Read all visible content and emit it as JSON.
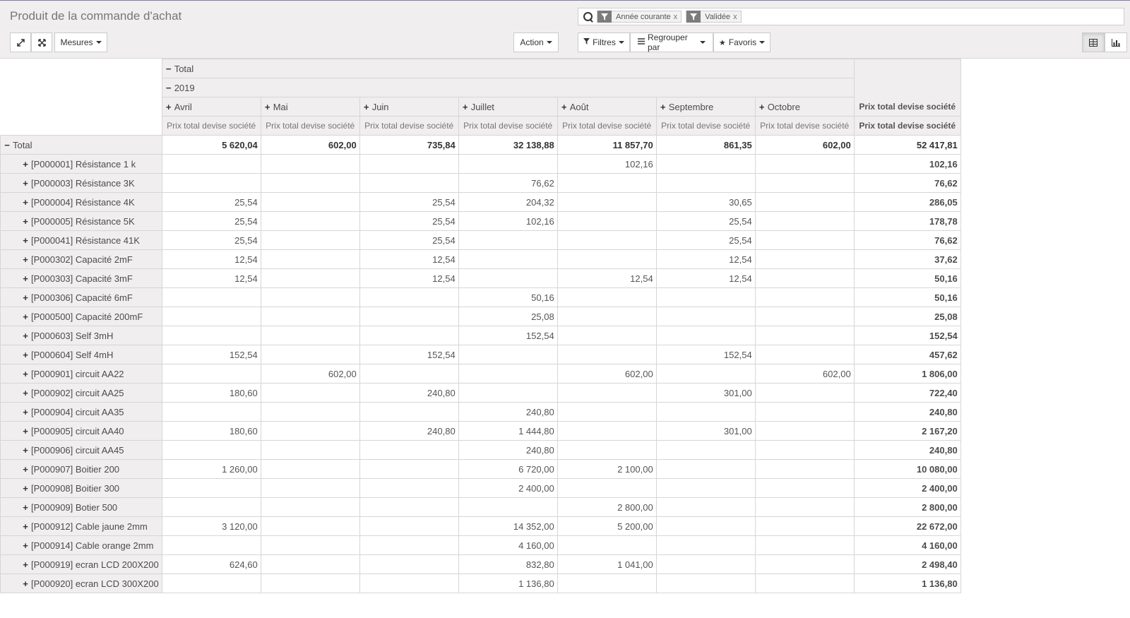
{
  "header": {
    "title": "Produit de la commande d'achat",
    "facets": [
      {
        "label": "Année courante",
        "remove": "x"
      },
      {
        "label": "Validée",
        "remove": "x"
      }
    ]
  },
  "toolbar": {
    "measures": "Mesures",
    "action": "Action",
    "filters": "Filtres",
    "group_by": "Regrouper par",
    "favorites": "Favoris"
  },
  "pivot": {
    "col_total": "Total",
    "year": "2019",
    "months": [
      "Avril",
      "Mai",
      "Juin",
      "Juillet",
      "Août",
      "Septembre",
      "Octobre"
    ],
    "measure": "Prix total devise société",
    "total_measure": "Prix total devise société",
    "row_total_label": "Total",
    "total_row": [
      "5 620,04",
      "602,00",
      "735,84",
      "32 138,88",
      "11 857,70",
      "861,35",
      "602,00",
      "52 417,81"
    ],
    "rows": [
      {
        "label": "[P000001] Résistance 1 k",
        "values": [
          "",
          "",
          "",
          "",
          "102,16",
          "",
          "",
          "102,16"
        ]
      },
      {
        "label": "[P000003] Résistance 3K",
        "values": [
          "",
          "",
          "",
          "76,62",
          "",
          "",
          "",
          "76,62"
        ]
      },
      {
        "label": "[P000004] Résistance 4K",
        "values": [
          "25,54",
          "",
          "25,54",
          "204,32",
          "",
          "30,65",
          "",
          "286,05"
        ]
      },
      {
        "label": "[P000005] Résistance 5K",
        "values": [
          "25,54",
          "",
          "25,54",
          "102,16",
          "",
          "25,54",
          "",
          "178,78"
        ]
      },
      {
        "label": "[P000041] Résistance 41K",
        "values": [
          "25,54",
          "",
          "25,54",
          "",
          "",
          "25,54",
          "",
          "76,62"
        ]
      },
      {
        "label": "[P000302] Capacité 2mF",
        "values": [
          "12,54",
          "",
          "12,54",
          "",
          "",
          "12,54",
          "",
          "37,62"
        ]
      },
      {
        "label": "[P000303] Capacité 3mF",
        "values": [
          "12,54",
          "",
          "12,54",
          "",
          "12,54",
          "12,54",
          "",
          "50,16"
        ]
      },
      {
        "label": "[P000306] Capacité 6mF",
        "values": [
          "",
          "",
          "",
          "50,16",
          "",
          "",
          "",
          "50,16"
        ]
      },
      {
        "label": "[P000500] Capacité 200mF",
        "values": [
          "",
          "",
          "",
          "25,08",
          "",
          "",
          "",
          "25,08"
        ]
      },
      {
        "label": "[P000603] Self 3mH",
        "values": [
          "",
          "",
          "",
          "152,54",
          "",
          "",
          "",
          "152,54"
        ]
      },
      {
        "label": "[P000604] Self 4mH",
        "values": [
          "152,54",
          "",
          "152,54",
          "",
          "",
          "152,54",
          "",
          "457,62"
        ]
      },
      {
        "label": "[P000901] circuit AA22",
        "values": [
          "",
          "602,00",
          "",
          "",
          "602,00",
          "",
          "602,00",
          "1 806,00"
        ]
      },
      {
        "label": "[P000902] circuit AA25",
        "values": [
          "180,60",
          "",
          "240,80",
          "",
          "",
          "301,00",
          "",
          "722,40"
        ]
      },
      {
        "label": "[P000904] circuit AA35",
        "values": [
          "",
          "",
          "",
          "240,80",
          "",
          "",
          "",
          "240,80"
        ]
      },
      {
        "label": "[P000905] circuit AA40",
        "values": [
          "180,60",
          "",
          "240,80",
          "1 444,80",
          "",
          "301,00",
          "",
          "2 167,20"
        ]
      },
      {
        "label": "[P000906] circuit AA45",
        "values": [
          "",
          "",
          "",
          "240,80",
          "",
          "",
          "",
          "240,80"
        ]
      },
      {
        "label": "[P000907] Boitier 200",
        "values": [
          "1 260,00",
          "",
          "",
          "6 720,00",
          "2 100,00",
          "",
          "",
          "10 080,00"
        ]
      },
      {
        "label": "[P000908] Boitier 300",
        "values": [
          "",
          "",
          "",
          "2 400,00",
          "",
          "",
          "",
          "2 400,00"
        ]
      },
      {
        "label": "[P000909] Botier 500",
        "values": [
          "",
          "",
          "",
          "",
          "2 800,00",
          "",
          "",
          "2 800,00"
        ]
      },
      {
        "label": "[P000912] Cable jaune 2mm",
        "values": [
          "3 120,00",
          "",
          "",
          "14 352,00",
          "5 200,00",
          "",
          "",
          "22 672,00"
        ]
      },
      {
        "label": "[P000914] Cable orange 2mm",
        "values": [
          "",
          "",
          "",
          "4 160,00",
          "",
          "",
          "",
          "4 160,00"
        ]
      },
      {
        "label": "[P000919] ecran LCD 200X200",
        "values": [
          "624,60",
          "",
          "",
          "832,80",
          "1 041,00",
          "",
          "",
          "2 498,40"
        ]
      },
      {
        "label": "[P000920] ecran LCD 300X200",
        "values": [
          "",
          "",
          "",
          "1 136,80",
          "",
          "",
          "",
          "1 136,80"
        ]
      }
    ]
  }
}
